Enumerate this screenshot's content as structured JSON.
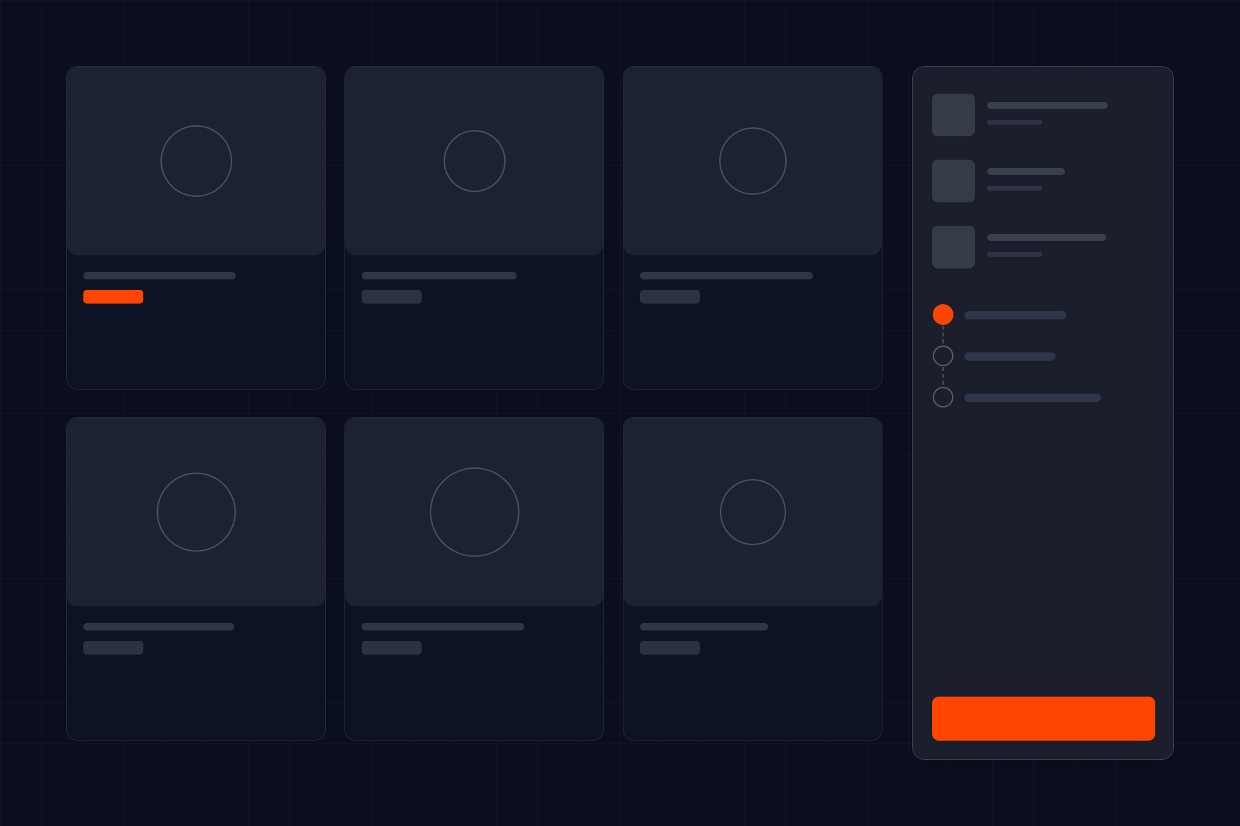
{
  "colors": {
    "background": "#0b0e1c",
    "card": "#0d1324",
    "card_image": "#1d2233",
    "panel": "#1b1f2c",
    "placeholder": "#2f3647",
    "accent": "#ff4500"
  },
  "grid": {
    "cards": [
      {
        "icon": "image-placeholder-circle",
        "tag_accent": true
      },
      {
        "icon": "image-placeholder-circle",
        "tag_accent": false
      },
      {
        "icon": "image-placeholder-circle",
        "tag_accent": false
      },
      {
        "icon": "image-placeholder-circle",
        "tag_accent": false
      },
      {
        "icon": "image-placeholder-circle",
        "tag_accent": false
      },
      {
        "icon": "image-placeholder-circle",
        "tag_accent": false
      }
    ]
  },
  "panel": {
    "items": [
      {
        "icon": "thumbnail-placeholder"
      },
      {
        "icon": "thumbnail-placeholder"
      },
      {
        "icon": "thumbnail-placeholder"
      }
    ],
    "steps": [
      {
        "state": "active"
      },
      {
        "state": "inactive"
      },
      {
        "state": "inactive"
      }
    ],
    "primary_button": {
      "label": ""
    }
  }
}
